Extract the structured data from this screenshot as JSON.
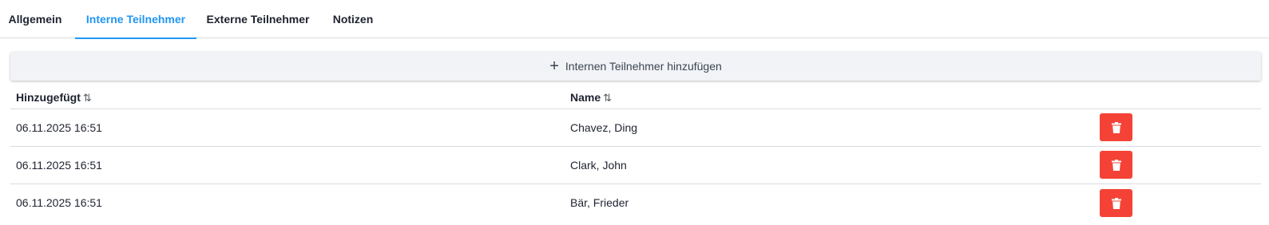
{
  "tabs": [
    {
      "label": "Allgemein",
      "active": false
    },
    {
      "label": "Interne Teilnehmer",
      "active": true
    },
    {
      "label": "Externe Teilnehmer",
      "active": false
    },
    {
      "label": "Notizen",
      "active": false
    }
  ],
  "add_button": {
    "label": "Internen Teilnehmer hinzufügen",
    "icon": "plus-icon"
  },
  "table": {
    "columns": [
      {
        "label": "Hinzugefügt",
        "sort_icon": "sort-icon"
      },
      {
        "label": "Name",
        "sort_icon": "sort-icon"
      }
    ],
    "rows": [
      {
        "added": "06.11.2025 16:51",
        "name": "Chavez, Ding"
      },
      {
        "added": "06.11.2025 16:51",
        "name": "Clark, John"
      },
      {
        "added": "06.11.2025 16:51",
        "name": "Bär, Frieder"
      }
    ]
  },
  "colors": {
    "accent": "#2196f3",
    "danger": "#f44336"
  }
}
